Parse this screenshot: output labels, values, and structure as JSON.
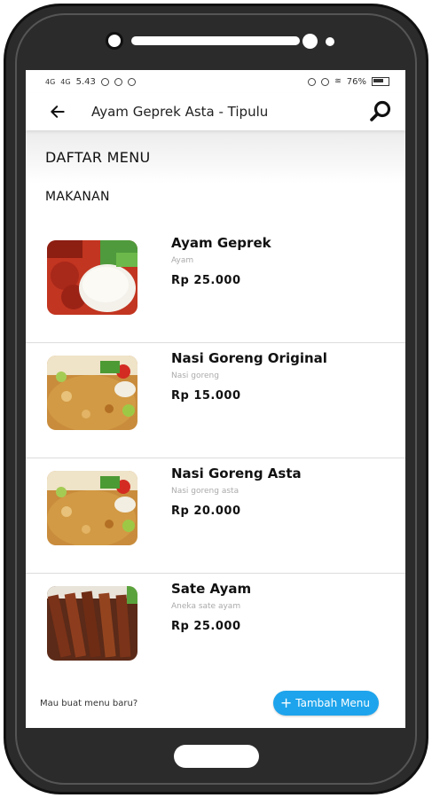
{
  "statusbar": {
    "signal": "4G",
    "time": "5.43",
    "battery": "76%"
  },
  "appbar": {
    "title": "Ayam Geprek Asta - Tipulu",
    "back_icon": "arrow-left-icon",
    "search_icon": "search-icon"
  },
  "header": {
    "title": "DAFTAR MENU"
  },
  "section": {
    "title": "MAKANAN"
  },
  "menu": [
    {
      "name": "Ayam Geprek",
      "description": "Ayam",
      "price": "Rp 25.000",
      "image": "ayam-geprek-photo"
    },
    {
      "name": "Nasi Goreng Original",
      "description": "Nasi goreng",
      "price": "Rp 15.000",
      "image": "nasi-goreng-photo"
    },
    {
      "name": "Nasi Goreng Asta",
      "description": "Nasi goreng asta",
      "price": "Rp 20.000",
      "image": "nasi-goreng-photo"
    },
    {
      "name": "Sate Ayam",
      "description": "Aneka sate ayam",
      "price": "Rp 25.000",
      "image": "sate-ayam-photo"
    }
  ],
  "footer": {
    "prompt": "Mau buat menu baru?",
    "button_label": "Tambah Menu",
    "button_color": "#1ea4ec"
  }
}
